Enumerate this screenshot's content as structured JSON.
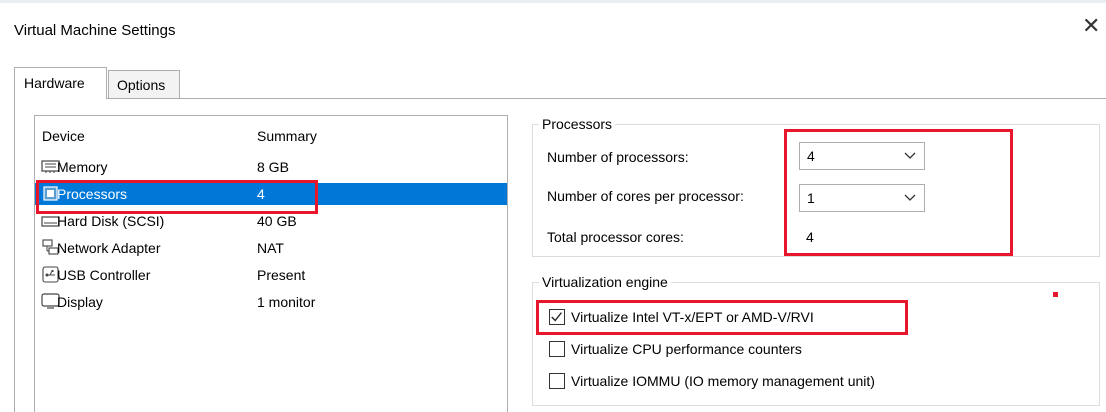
{
  "window": {
    "title": "Virtual Machine Settings",
    "close_glyph": "✕"
  },
  "tabs": [
    {
      "label": "Hardware",
      "active": true
    },
    {
      "label": "Options",
      "active": false
    }
  ],
  "device_list": {
    "headers": {
      "device": "Device",
      "summary": "Summary"
    },
    "items": [
      {
        "icon": "memory-icon",
        "name": "Memory",
        "summary": "8 GB",
        "selected": false
      },
      {
        "icon": "processor-icon",
        "name": "Processors",
        "summary": "4",
        "selected": true
      },
      {
        "icon": "hard-disk-icon",
        "name": "Hard Disk (SCSI)",
        "summary": "40 GB",
        "selected": false
      },
      {
        "icon": "network-adapter-icon",
        "name": "Network Adapter",
        "summary": "NAT",
        "selected": false
      },
      {
        "icon": "usb-controller-icon",
        "name": "USB Controller",
        "summary": "Present",
        "selected": false
      },
      {
        "icon": "display-icon",
        "name": "Display",
        "summary": "1 monitor",
        "selected": false
      }
    ]
  },
  "processors": {
    "legend": "Processors",
    "num_processors_label": "Number of processors:",
    "num_processors_value": "4",
    "cores_label": "Number of cores per processor:",
    "cores_value": "1",
    "total_label": "Total processor cores:",
    "total_value": "4"
  },
  "virtualization": {
    "legend": "Virtualization engine",
    "options": [
      {
        "label": "Virtualize Intel VT-x/EPT or AMD-V/RVI",
        "checked": true
      },
      {
        "label": "Virtualize CPU performance counters",
        "checked": false
      },
      {
        "label": "Virtualize IOMMU (IO memory management unit)",
        "checked": false
      }
    ]
  },
  "colors": {
    "selection": "#0078d7",
    "highlight": "#e8162a"
  }
}
